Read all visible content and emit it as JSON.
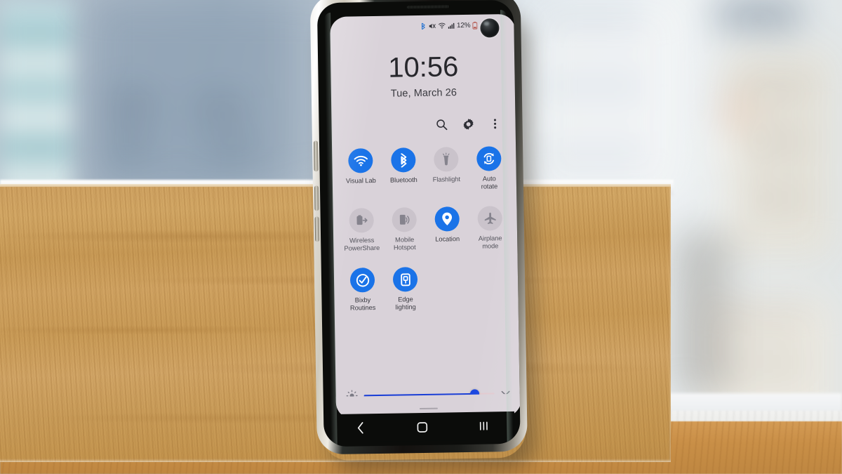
{
  "device": {
    "name": "Samsung Galaxy S10e",
    "frame_color": "#e9e6df",
    "screen_bg": "#d9d2d9",
    "accent_on": "#1a73e8",
    "accent_slider": "#1a46e0",
    "tile_off_bg": "rgba(110,105,118,0.14)",
    "nav_bg": "#0b0c0a"
  },
  "scene": {
    "board_color": "#c99b57",
    "table_color": "#c98f47",
    "background_description": "blurred city buildings"
  },
  "status_bar": {
    "icons": [
      "bluetooth-icon",
      "mute-vibrate-icon",
      "wifi-icon",
      "signal-bars-icon"
    ],
    "battery_percent": "12%",
    "battery_icon": "battery-low-icon"
  },
  "lock_header": {
    "time": "10:56",
    "date": "Tue, March 26"
  },
  "quick_settings": {
    "header_buttons": [
      {
        "name": "search-icon",
        "label": "Search"
      },
      {
        "name": "gear-icon",
        "label": "Settings"
      },
      {
        "name": "more-vert-icon",
        "label": "More options"
      }
    ],
    "tiles": [
      {
        "label": "Visual Lab",
        "icon": "wifi-icon",
        "state": "on"
      },
      {
        "label": "Bluetooth",
        "icon": "bluetooth-icon",
        "state": "on"
      },
      {
        "label": "Flashlight",
        "icon": "flashlight-icon",
        "state": "off"
      },
      {
        "label": "Auto\nrotate",
        "icon": "auto-rotate-icon",
        "state": "on"
      },
      {
        "label": "Wireless\nPowerShare",
        "icon": "wireless-powershare-icon",
        "state": "off"
      },
      {
        "label": "Mobile\nHotspot",
        "icon": "mobile-hotspot-icon",
        "state": "off"
      },
      {
        "label": "Location",
        "icon": "location-pin-icon",
        "state": "on"
      },
      {
        "label": "Airplane\nmode",
        "icon": "airplane-icon",
        "state": "off"
      },
      {
        "label": "Bixby\nRoutines",
        "icon": "bixby-routines-icon",
        "state": "on"
      },
      {
        "label": "Edge\nlighting",
        "icon": "edge-lighting-icon",
        "state": "on"
      }
    ],
    "brightness": {
      "icon": "brightness-sun-icon",
      "value_percent": 85,
      "expand_icon": "chevron-down-icon"
    },
    "panel_handle": "drag-handle"
  },
  "nav_bar": {
    "buttons": [
      {
        "name": "back-button",
        "icon": "chevron-left-icon"
      },
      {
        "name": "home-button",
        "icon": "rounded-square-icon"
      },
      {
        "name": "recents-button",
        "icon": "three-bars-icon"
      }
    ]
  }
}
